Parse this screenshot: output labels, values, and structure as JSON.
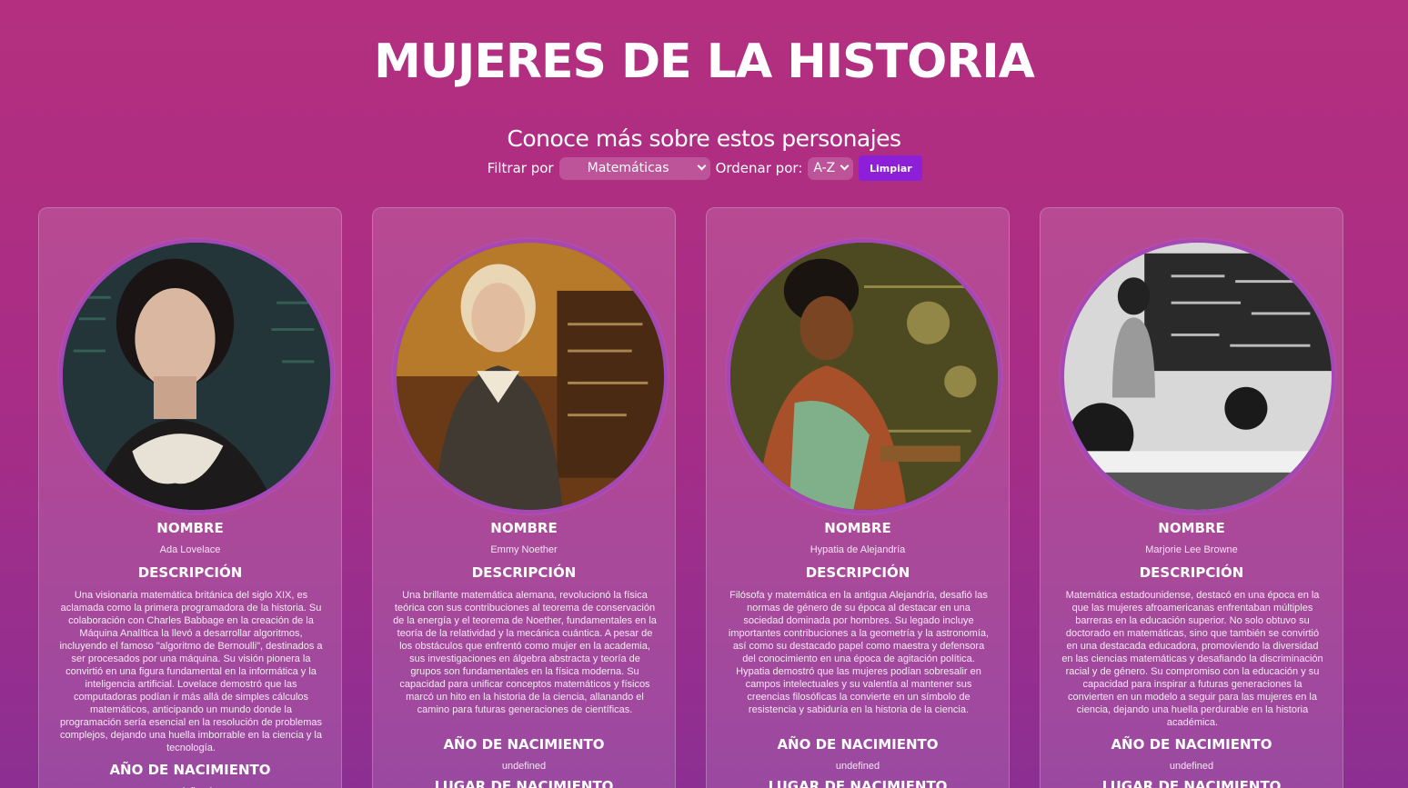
{
  "header": {
    "title": "MUJERES DE LA HISTORIA",
    "subtitle": "Conoce más sobre estos personajes"
  },
  "controls": {
    "filter_label": "Filtrar por",
    "filter_value": "Matemáticas",
    "order_label": "Ordenar por:",
    "order_value": "A-Z",
    "clear_label": "Limpiar"
  },
  "labels": {
    "name": "NOMBRE",
    "description": "DESCRIPCIÓN",
    "birth_year": "AÑO DE NACIMIENTO",
    "birth_place": "LUGAR DE NACIMIENTO"
  },
  "cards": [
    {
      "name": "Ada Lovelace",
      "description": "Una visionaria matemática británica del siglo XIX, es aclamada como la primera programadora de la historia. Su colaboración con Charles Babbage en la creación de la Máquina Analítica la llevó a desarrollar algoritmos, incluyendo el famoso \"algoritmo de Bernoulli\", destinados a ser procesados por una máquina. Su visión pionera la convirtió en una figura fundamental en la informática y la inteligencia artificial. Lovelace demostró que las computadoras podían ir más allá de simples cálculos matemáticos, anticipando un mundo donde la programación sería esencial en la resolución de problemas complejos, dejando una huella imborrable en la ciencia y la tecnología.",
      "birth_year": "undefined"
    },
    {
      "name": "Emmy Noether",
      "description": "Una brillante matemática alemana, revolucionó la física teórica con sus contribuciones al teorema de conservación de la energía y el teorema de Noether, fundamentales en la teoría de la relatividad y la mecánica cuántica. A pesar de los obstáculos que enfrentó como mujer en la academia, sus investigaciones en álgebra abstracta y teoría de grupos son fundamentales en la física moderna. Su capacidad para unificar conceptos matemáticos y físicos marcó un hito en la historia de la ciencia, allanando el camino para futuras generaciones de científicas.",
      "birth_year": "undefined"
    },
    {
      "name": "Hypatia de Alejandría",
      "description": "Filósofa y matemática en la antigua Alejandría, desafió las normas de género de su época al destacar en una sociedad dominada por hombres. Su legado incluye importantes contribuciones a la geometría y la astronomía, así como su destacado papel como maestra y defensora del conocimiento en una época de agitación política. Hypatia demostró que las mujeres podían sobresalir en campos intelectuales y su valentía al mantener sus creencias filosóficas la convierte en un símbolo de resistencia y sabiduría en la historia de la ciencia.",
      "birth_year": "undefined"
    },
    {
      "name": "Marjorie Lee Browne",
      "description": "Matemática estadounidense, destacó en una época en la que las mujeres afroamericanas enfrentaban múltiples barreras en la educación superior. No solo obtuvo su doctorado en matemáticas, sino que también se convirtió en una destacada educadora, promoviendo la diversidad en las ciencias matemáticas y desafiando la discriminación racial y de género. Su compromiso con la educación y su capacidad para inspirar a futuras generaciones la convierten en un modelo a seguir para las mujeres en la ciencia, dejando una huella perdurable en la historia académica.",
      "birth_year": "undefined"
    }
  ]
}
